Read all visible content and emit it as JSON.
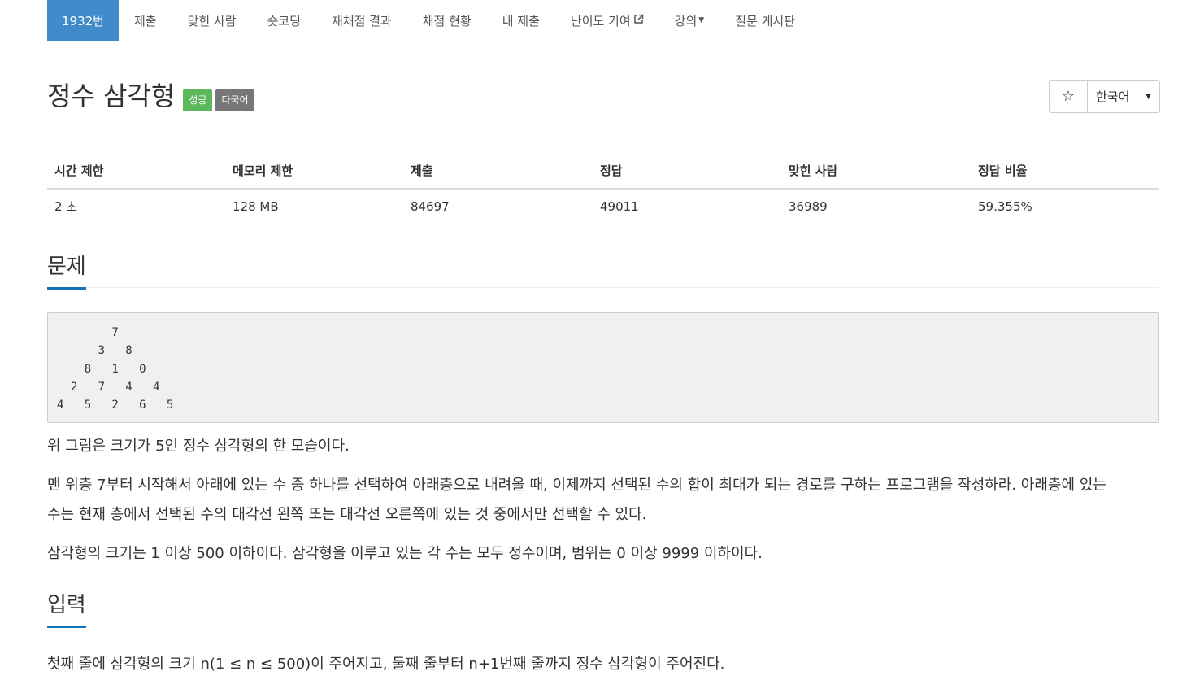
{
  "nav": {
    "items": [
      {
        "label": "1932번"
      },
      {
        "label": "제출"
      },
      {
        "label": "맞힌 사람"
      },
      {
        "label": "숏코딩"
      },
      {
        "label": "재채점 결과"
      },
      {
        "label": "채점 현황"
      },
      {
        "label": "내 제출"
      },
      {
        "label": "난이도 기여",
        "icon": "external-link-icon"
      },
      {
        "label": "강의",
        "icon": "caret-down-icon"
      },
      {
        "label": "질문 게시판"
      }
    ]
  },
  "problem": {
    "title": "정수 삼각형",
    "badges": {
      "success": "성공",
      "multilang": "다국어"
    }
  },
  "toolbar": {
    "star_icon": "star-outline-icon",
    "language": "한국어"
  },
  "info_table": {
    "headers": [
      "시간 제한",
      "메모리 제한",
      "제출",
      "정답",
      "맞힌 사람",
      "정답 비율"
    ],
    "row": [
      "2 초",
      "128 MB",
      "84697",
      "49011",
      "36989",
      "59.355%"
    ]
  },
  "sections": {
    "problem_heading": "문제",
    "input_heading": "입력"
  },
  "problem_body": {
    "triangle": "        7\n      3   8\n    8   1   0\n  2   7   4   4\n4   5   2   6   5",
    "p1": "위 그림은 크기가 5인 정수 삼각형의 한 모습이다.",
    "p2a": "맨 위층 7부터 시작해서 아래에 있는 수 중 하나를 선택하여 아래층으로 내려올 때, 이제까지 선택된 수의 합이 최대가 되는 경로를 구하는 프로그램을 작성하라. 아래층에 있는",
    "p2b": "수는 현재 층에서 선택된 수의 대각선 왼쪽 또는 대각선 오른쪽에 있는 것 중에서만 선택할 수 있다.",
    "p3": "삼각형의 크기는 1 이상 500 이하이다. 삼각형을 이루고 있는 각 수는 모두 정수이며, 범위는 0 이상 9999 이하이다."
  },
  "input_body": {
    "p1": "첫째 줄에 삼각형의 크기 n(1 ≤ n ≤ 500)이 주어지고, 둘째 줄부터 n+1번째 줄까지 정수 삼각형이 주어진다."
  }
}
